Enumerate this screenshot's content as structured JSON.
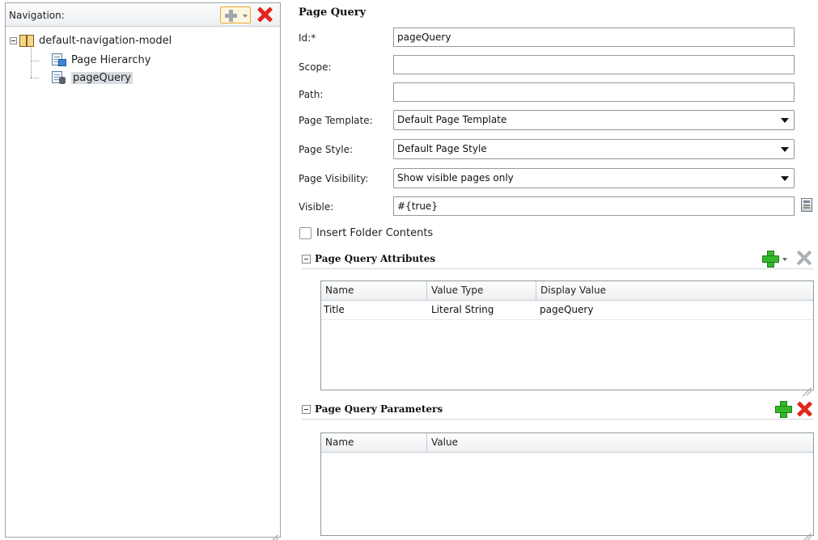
{
  "navigation": {
    "title": "Navigation:",
    "tree": {
      "root": {
        "label": "default-navigation-model",
        "icon": "book-icon"
      },
      "children": [
        {
          "label": "Page Hierarchy",
          "icon": "page-hierarchy-icon",
          "selected": false
        },
        {
          "label": "pageQuery",
          "icon": "page-query-icon",
          "selected": true
        }
      ]
    },
    "toolbar_icons": [
      "add-icon",
      "delete-icon"
    ]
  },
  "form": {
    "title": "Page Query",
    "id": {
      "label": "Id:*",
      "value": "pageQuery"
    },
    "scope": {
      "label": "Scope:",
      "value": ""
    },
    "path": {
      "label": "Path:",
      "value": ""
    },
    "page_template": {
      "label": "Page Template:",
      "value": "Default Page Template"
    },
    "page_style": {
      "label": "Page Style:",
      "value": "Default Page Style"
    },
    "page_visibility": {
      "label": "Page Visibility:",
      "value": "Show visible pages only"
    },
    "visible": {
      "label": "Visible:",
      "value": "#{true}"
    },
    "insert_folder_contents": {
      "label": "Insert Folder Contents",
      "checked": false
    }
  },
  "attributes_section": {
    "title": "Page Query Attributes",
    "columns": [
      "Name",
      "Value Type",
      "Display Value"
    ],
    "rows": [
      {
        "name": "Title",
        "value_type": "Literal String",
        "display_value": "pageQuery"
      }
    ]
  },
  "parameters_section": {
    "title": "Page Query Parameters",
    "columns": [
      "Name",
      "Value"
    ],
    "rows": []
  },
  "colors": {
    "add_green": "#33b82a",
    "delete_red": "#e2261b",
    "selection_bg": "#d8dde2",
    "active_button_border": "#f0a830"
  }
}
